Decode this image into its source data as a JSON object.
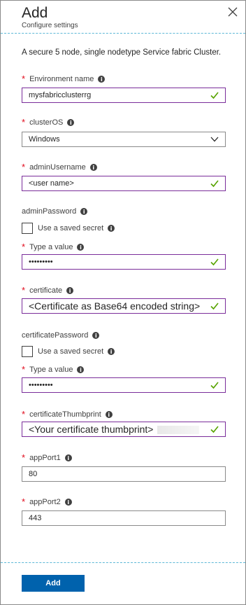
{
  "header": {
    "title": "Add",
    "subtitle": "Configure settings"
  },
  "description": "A secure 5 node, single nodetype Service fabric Cluster.",
  "fields": {
    "environment_name": {
      "label": "Environment name",
      "value": "mysfabricclusterrg"
    },
    "cluster_os": {
      "label": "clusterOS",
      "value": "Windows"
    },
    "admin_username": {
      "label": "adminUsername",
      "value": "<user name>"
    },
    "admin_password": {
      "label": "adminPassword",
      "use_saved_secret": "Use a saved secret",
      "type_value_label": "Type a value",
      "value": "•••••••••"
    },
    "certificate": {
      "label": "certificate",
      "value": "<Certificate as Base64 encoded string>"
    },
    "certificate_password": {
      "label": "certificatePassword",
      "use_saved_secret": "Use a saved secret",
      "type_value_label": "Type a value",
      "value": "•••••••••"
    },
    "certificate_thumbprint": {
      "label": "certificateThumbprint",
      "value": "<Your certificate thumbprint>"
    },
    "app_port1": {
      "label": "appPort1",
      "value": "80"
    },
    "app_port2": {
      "label": "appPort2",
      "value": "443"
    }
  },
  "footer": {
    "add_label": "Add"
  },
  "icons": {
    "close": "close-icon",
    "info": "info-icon",
    "check": "checkmark-icon",
    "chevron": "chevron-down-icon"
  },
  "colors": {
    "accent": "#0062ad",
    "valid_border": "#7a2d9a",
    "check": "#57a300",
    "required": "#e00b1c",
    "divider": "#5cb8d6"
  }
}
